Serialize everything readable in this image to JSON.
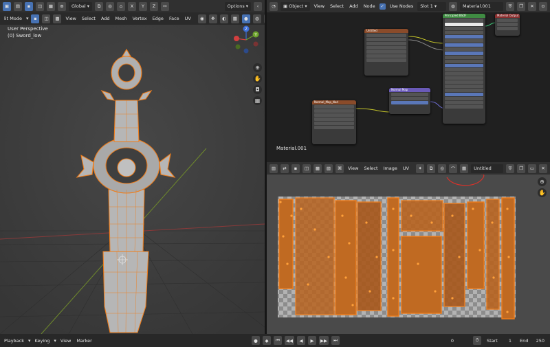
{
  "viewport3d": {
    "header": {
      "mode": "lit Mode",
      "orientation": "Global",
      "axes": [
        "X",
        "Y",
        "Z"
      ],
      "menus": [
        "View",
        "Select",
        "Add",
        "Mesh",
        "Vertex",
        "Edge",
        "Face",
        "UV"
      ],
      "options_label": "Options"
    },
    "overlay": {
      "perspective": "User Perspective",
      "object": "(0) Sword_low"
    },
    "gizmo": {
      "y_label": "Y",
      "z_label": "Z"
    }
  },
  "node_editor": {
    "header": {
      "object_label": "Object",
      "menus": [
        "View",
        "Select",
        "Add",
        "Node"
      ],
      "use_nodes_label": "Use Nodes",
      "slot": "Slot 1",
      "material": "Material.001"
    },
    "material_label": "Material.001",
    "nodes": {
      "image_texture": {
        "title": "Untitled"
      },
      "principled": {
        "title": "Principled BSDF"
      },
      "output": {
        "title": "Material Output"
      },
      "normal_map": {
        "title": "Normal Map"
      },
      "normal_image": {
        "title": "Normal_Map_Nod"
      }
    }
  },
  "uv_editor": {
    "header": {
      "menus": [
        "View",
        "Select",
        "Image",
        "UV"
      ],
      "image_name": "Untitled"
    }
  },
  "timeline": {
    "menus": [
      "Playback",
      "Keying",
      "View",
      "Marker"
    ],
    "current_frame": "0",
    "start_label": "Start",
    "start": "1",
    "end_label": "End",
    "end": "250"
  },
  "colors": {
    "accent": "#4772b3",
    "selection_orange": "#f07d1a",
    "uv_background": "#4a4a4a",
    "node_bg": "#202020"
  }
}
